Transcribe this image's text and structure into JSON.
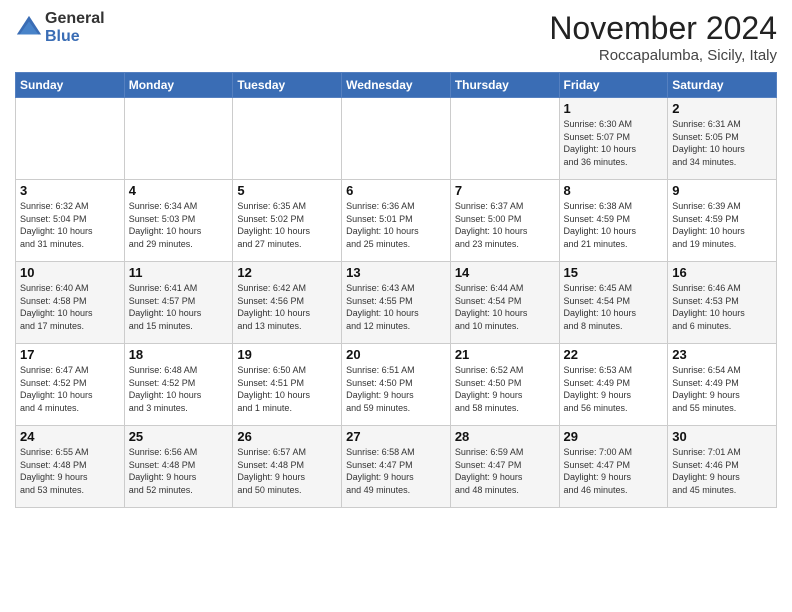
{
  "logo": {
    "general": "General",
    "blue": "Blue"
  },
  "header": {
    "month": "November 2024",
    "location": "Roccapalumba, Sicily, Italy"
  },
  "days_of_week": [
    "Sunday",
    "Monday",
    "Tuesday",
    "Wednesday",
    "Thursday",
    "Friday",
    "Saturday"
  ],
  "weeks": [
    [
      {
        "day": "",
        "info": ""
      },
      {
        "day": "",
        "info": ""
      },
      {
        "day": "",
        "info": ""
      },
      {
        "day": "",
        "info": ""
      },
      {
        "day": "",
        "info": ""
      },
      {
        "day": "1",
        "info": "Sunrise: 6:30 AM\nSunset: 5:07 PM\nDaylight: 10 hours\nand 36 minutes."
      },
      {
        "day": "2",
        "info": "Sunrise: 6:31 AM\nSunset: 5:05 PM\nDaylight: 10 hours\nand 34 minutes."
      }
    ],
    [
      {
        "day": "3",
        "info": "Sunrise: 6:32 AM\nSunset: 5:04 PM\nDaylight: 10 hours\nand 31 minutes."
      },
      {
        "day": "4",
        "info": "Sunrise: 6:34 AM\nSunset: 5:03 PM\nDaylight: 10 hours\nand 29 minutes."
      },
      {
        "day": "5",
        "info": "Sunrise: 6:35 AM\nSunset: 5:02 PM\nDaylight: 10 hours\nand 27 minutes."
      },
      {
        "day": "6",
        "info": "Sunrise: 6:36 AM\nSunset: 5:01 PM\nDaylight: 10 hours\nand 25 minutes."
      },
      {
        "day": "7",
        "info": "Sunrise: 6:37 AM\nSunset: 5:00 PM\nDaylight: 10 hours\nand 23 minutes."
      },
      {
        "day": "8",
        "info": "Sunrise: 6:38 AM\nSunset: 4:59 PM\nDaylight: 10 hours\nand 21 minutes."
      },
      {
        "day": "9",
        "info": "Sunrise: 6:39 AM\nSunset: 4:59 PM\nDaylight: 10 hours\nand 19 minutes."
      }
    ],
    [
      {
        "day": "10",
        "info": "Sunrise: 6:40 AM\nSunset: 4:58 PM\nDaylight: 10 hours\nand 17 minutes."
      },
      {
        "day": "11",
        "info": "Sunrise: 6:41 AM\nSunset: 4:57 PM\nDaylight: 10 hours\nand 15 minutes."
      },
      {
        "day": "12",
        "info": "Sunrise: 6:42 AM\nSunset: 4:56 PM\nDaylight: 10 hours\nand 13 minutes."
      },
      {
        "day": "13",
        "info": "Sunrise: 6:43 AM\nSunset: 4:55 PM\nDaylight: 10 hours\nand 12 minutes."
      },
      {
        "day": "14",
        "info": "Sunrise: 6:44 AM\nSunset: 4:54 PM\nDaylight: 10 hours\nand 10 minutes."
      },
      {
        "day": "15",
        "info": "Sunrise: 6:45 AM\nSunset: 4:54 PM\nDaylight: 10 hours\nand 8 minutes."
      },
      {
        "day": "16",
        "info": "Sunrise: 6:46 AM\nSunset: 4:53 PM\nDaylight: 10 hours\nand 6 minutes."
      }
    ],
    [
      {
        "day": "17",
        "info": "Sunrise: 6:47 AM\nSunset: 4:52 PM\nDaylight: 10 hours\nand 4 minutes."
      },
      {
        "day": "18",
        "info": "Sunrise: 6:48 AM\nSunset: 4:52 PM\nDaylight: 10 hours\nand 3 minutes."
      },
      {
        "day": "19",
        "info": "Sunrise: 6:50 AM\nSunset: 4:51 PM\nDaylight: 10 hours\nand 1 minute."
      },
      {
        "day": "20",
        "info": "Sunrise: 6:51 AM\nSunset: 4:50 PM\nDaylight: 9 hours\nand 59 minutes."
      },
      {
        "day": "21",
        "info": "Sunrise: 6:52 AM\nSunset: 4:50 PM\nDaylight: 9 hours\nand 58 minutes."
      },
      {
        "day": "22",
        "info": "Sunrise: 6:53 AM\nSunset: 4:49 PM\nDaylight: 9 hours\nand 56 minutes."
      },
      {
        "day": "23",
        "info": "Sunrise: 6:54 AM\nSunset: 4:49 PM\nDaylight: 9 hours\nand 55 minutes."
      }
    ],
    [
      {
        "day": "24",
        "info": "Sunrise: 6:55 AM\nSunset: 4:48 PM\nDaylight: 9 hours\nand 53 minutes."
      },
      {
        "day": "25",
        "info": "Sunrise: 6:56 AM\nSunset: 4:48 PM\nDaylight: 9 hours\nand 52 minutes."
      },
      {
        "day": "26",
        "info": "Sunrise: 6:57 AM\nSunset: 4:48 PM\nDaylight: 9 hours\nand 50 minutes."
      },
      {
        "day": "27",
        "info": "Sunrise: 6:58 AM\nSunset: 4:47 PM\nDaylight: 9 hours\nand 49 minutes."
      },
      {
        "day": "28",
        "info": "Sunrise: 6:59 AM\nSunset: 4:47 PM\nDaylight: 9 hours\nand 48 minutes."
      },
      {
        "day": "29",
        "info": "Sunrise: 7:00 AM\nSunset: 4:47 PM\nDaylight: 9 hours\nand 46 minutes."
      },
      {
        "day": "30",
        "info": "Sunrise: 7:01 AM\nSunset: 4:46 PM\nDaylight: 9 hours\nand 45 minutes."
      }
    ]
  ]
}
